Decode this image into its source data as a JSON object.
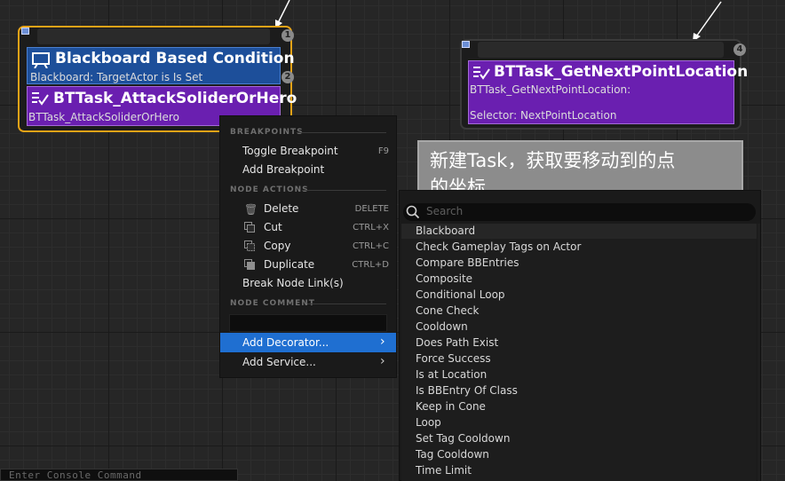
{
  "nodes": {
    "left": {
      "badge_top": "1",
      "badge_mid": "2",
      "decorator_title": "Blackboard Based Condition",
      "decorator_sub": "Blackboard: TargetActor is Is Set",
      "task_title": "BTTask_AttackSoliderOrHero",
      "task_sub": "BTTask_AttackSoliderOrHero"
    },
    "right": {
      "badge": "4",
      "task_title": "BTTask_GetNextPointLocation",
      "task_sub1": "BTTask_GetNextPointLocation:",
      "task_sub2": "Selector: NextPointLocation"
    }
  },
  "comment": {
    "line1": "新建Task，获取要移动到的点",
    "line2": "的坐标"
  },
  "context_menu": {
    "section_breakpoints": "BREAKPOINTS",
    "toggle_breakpoint": "Toggle Breakpoint",
    "toggle_breakpoint_sc": "F9",
    "add_breakpoint": "Add Breakpoint",
    "section_node_actions": "NODE ACTIONS",
    "delete": "Delete",
    "delete_sc": "DELETE",
    "cut": "Cut",
    "cut_sc": "CTRL+X",
    "copy": "Copy",
    "copy_sc": "CTRL+C",
    "duplicate": "Duplicate",
    "duplicate_sc": "CTRL+D",
    "break_links": "Break Node Link(s)",
    "section_node_comment": "NODE COMMENT",
    "add_decorator": "Add Decorator...",
    "add_service": "Add Service..."
  },
  "submenu": {
    "search_placeholder": "Search",
    "items": [
      "Blackboard",
      "Check Gameplay Tags on Actor",
      "Compare BBEntries",
      "Composite",
      "Conditional Loop",
      "Cone Check",
      "Cooldown",
      "Does Path Exist",
      "Force Success",
      "Is at Location",
      "Is BBEntry Of Class",
      "Keep in Cone",
      "Loop",
      "Set Tag Cooldown",
      "Tag Cooldown",
      "Time Limit"
    ]
  },
  "console": {
    "placeholder": "Enter Console Command"
  },
  "colors": {
    "selected_node_border": "#e6a317",
    "decorator_blue": "#1d4f9a",
    "task_purple": "#6a1fb0",
    "menu_highlight": "#1f6fd1"
  }
}
